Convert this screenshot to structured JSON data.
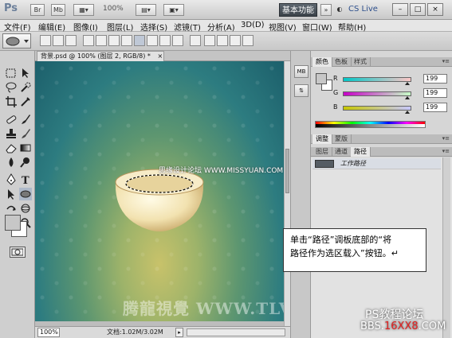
{
  "app": {
    "logo": "Ps",
    "zoom": "100%",
    "workspace_button": "基本功能",
    "cs_live": "CS Live",
    "window_minimize": "–",
    "window_restore": "□",
    "window_close": "×"
  },
  "menu": {
    "items": [
      "文件(F)",
      "编辑(E)",
      "图像(I)",
      "图层(L)",
      "选择(S)",
      "滤镜(T)",
      "分析(A)",
      "3D(D)",
      "视图(V)",
      "窗口(W)",
      "帮助(H)"
    ]
  },
  "document": {
    "tab_title": "背景.psd @ 100% (图层 2, RGB/8) *",
    "close": "×",
    "status_zoom": "100%",
    "status_info": "文档:1.02M/3.02M",
    "status_arrow": "▸"
  },
  "canvas": {
    "watermark_site": "思缘设计论坛 WWW.MISSYUAN.COM",
    "watermark_bottom": "腾龍視覺 WWW.TLVI.NET"
  },
  "panels": {
    "color_tabs": [
      "颜色",
      "色板",
      "样式"
    ],
    "adjust_tabs": [
      "调整",
      "蒙版"
    ],
    "layer_tabs": [
      "图层",
      "通道",
      "路径"
    ],
    "color": {
      "r_label": "R",
      "g_label": "G",
      "b_label": "B",
      "r_value": "199",
      "g_value": "199",
      "b_value": "199",
      "r": 199,
      "g": 199,
      "b": 199
    },
    "paths": {
      "work_path": "工作路径"
    }
  },
  "dock_icons": [
    "MB",
    "⇅"
  ],
  "callout": {
    "line1": "单击“路径”调板底部的“将",
    "line2": "路径作为选区载入”按钮。↵"
  },
  "footer": {
    "line1": "PS教程论坛",
    "line2_prefix": "BBS.",
    "line2_red": "16XX8",
    "line2_suffix": ".COM"
  },
  "colors": {
    "canvas_teal": "#1c5f6b",
    "canvas_yellow": "#c8c26a",
    "workspace_bg": "#3b4249"
  }
}
